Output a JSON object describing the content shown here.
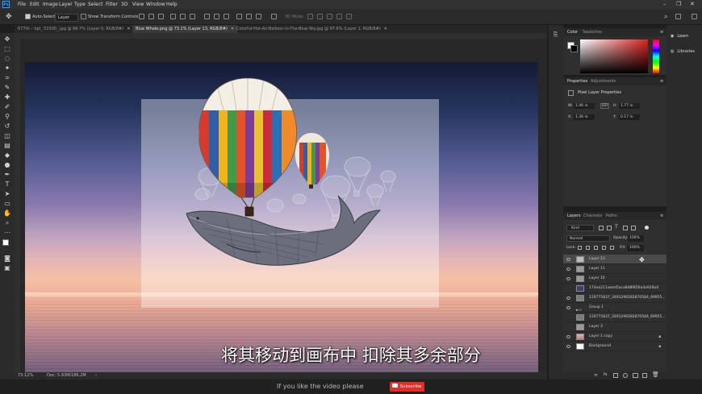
{
  "app": {
    "logo": "Ps"
  },
  "menu": [
    "File",
    "Edit",
    "Image",
    "Layer",
    "Type",
    "Select",
    "Filter",
    "3D",
    "View",
    "Window",
    "Help"
  ],
  "options_bar": {
    "auto_select_label": "Auto-Select:",
    "auto_select_value": "Layer",
    "transform_label": "Show Transform Controls",
    "mode_3d": "3D Mode:"
  },
  "tabs": [
    {
      "label": "677th – hpl_ 51500_.jpg @ 66.7% (Layer 0, RGB/8#)",
      "active": false
    },
    {
      "label": "Blue Whale.png @ 73.1% (Layer 13, RGB/8#)",
      "active": true
    },
    {
      "label": "Colorful-Hot-Air-Balloon-In-The-Blue-Sky.jpg @ 97.6% (Layer 1, RGB/8#)",
      "active": false
    }
  ],
  "status": {
    "zoom": "73.12%",
    "doc": "Doc: 5.93M/186.2M"
  },
  "panels": {
    "color_tabs": [
      "Color",
      "Swatches"
    ],
    "properties_tabs": [
      "Properties",
      "Adjustments"
    ],
    "properties_title": "Pixel Layer Properties",
    "props": {
      "w_label": "W:",
      "w": "1.46 in",
      "h_label": "H:",
      "h": "1.77 in",
      "x_label": "X:",
      "x": "1.36 in",
      "y_label": "Y:",
      "y": "0.17 in",
      "link": "GO"
    },
    "layers_tabs": [
      "Layers",
      "Channels",
      "Paths"
    ],
    "layers_filter": "Kind",
    "blend_mode": "Normal",
    "opacity_label": "Opacity:",
    "opacity": "100%",
    "lock_label": "Lock:",
    "fill_label": "Fill:",
    "fill": "100%"
  },
  "layers": [
    {
      "name": "Layer 13",
      "visible": true,
      "selected": true
    },
    {
      "name": "Layer 11",
      "visible": true
    },
    {
      "name": "Layer 10",
      "visible": true
    },
    {
      "name": "174ea211aeed5aca8d8f856a4a920a4",
      "visible": false
    },
    {
      "name": "119775837_3491296282870584_69955...",
      "visible": true
    },
    {
      "name": "Group 1",
      "visible": true
    },
    {
      "name": "119775837_3491296282870584_69955...",
      "visible": false
    },
    {
      "name": "Layer 3",
      "visible": false
    },
    {
      "name": "Layer 1 copy",
      "visible": true,
      "locked": true
    },
    {
      "name": "Background",
      "visible": true,
      "locked": true
    }
  ],
  "side_buttons": [
    "Learn",
    "Libraries"
  ],
  "subtitle": "将其移动到画布中 扣除其多余部分",
  "bottom": {
    "message": "If you like the video please",
    "subscribe": "Subscribe"
  },
  "colors": {
    "accent": "#31a8ff",
    "subscribe": "#e52d27",
    "ui_dark": "#2b2b2b"
  }
}
